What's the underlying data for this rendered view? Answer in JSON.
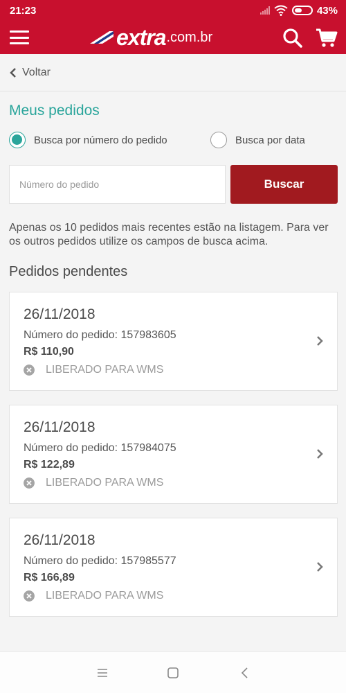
{
  "status_bar": {
    "time": "21:23",
    "battery": "43%",
    "signal_icon": "signal-icon",
    "wifi_icon": "wifi-icon",
    "battery_icon": "battery-icon"
  },
  "app_bar": {
    "brand": "extra",
    "domain_suffix": ".com.br",
    "menu_icon": "menu-icon",
    "search_icon": "search-icon",
    "cart_icon": "cart-icon",
    "color": "#c8102e"
  },
  "back": {
    "label": "Voltar",
    "icon": "chevron-left-icon"
  },
  "page_title": "Meus pedidos",
  "search_mode": {
    "options": [
      {
        "label": "Busca por número do pedido",
        "checked": true
      },
      {
        "label": "Busca por data",
        "checked": false
      }
    ]
  },
  "search": {
    "placeholder": "Número do pedido",
    "button_label": "Buscar"
  },
  "info_text": "Apenas os 10 pedidos mais recentes estão na listagem. Para ver os outros pedidos utilize os campos de busca acima.",
  "pending": {
    "title": "Pedidos pendentes",
    "orders": [
      {
        "date": "26/11/2018",
        "number": "Número do pedido: 157983605",
        "price": "R$ 110,90",
        "status": "LIBERADO PARA WMS"
      },
      {
        "date": "26/11/2018",
        "number": "Número do pedido: 157984075",
        "price": "R$ 122,89",
        "status": "LIBERADO PARA WMS"
      },
      {
        "date": "26/11/2018",
        "number": "Número do pedido: 157985577",
        "price": "R$ 166,89",
        "status": "LIBERADO PARA WMS"
      }
    ]
  },
  "colors": {
    "accent_teal": "#2aa59b",
    "button_red": "#a11a1f"
  },
  "system_nav": {
    "menu_icon": "recent-apps-icon",
    "home_icon": "home-icon",
    "back_icon": "back-icon"
  }
}
